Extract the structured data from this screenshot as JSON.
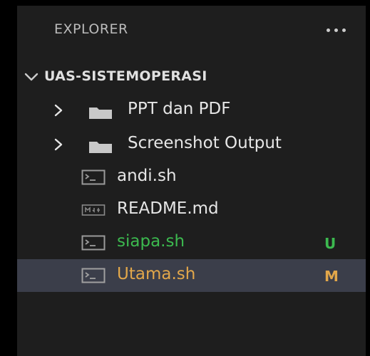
{
  "panel": {
    "title": "EXPLORER",
    "more_icon": "ellipsis-icon"
  },
  "workspace": {
    "name": "UAS-SISTEMOPERASI",
    "expanded": true
  },
  "items": [
    {
      "type": "folder",
      "label": "PPT dan PDF",
      "icon": "folder-icon",
      "expanded": false
    },
    {
      "type": "folder",
      "label": "Screenshot Output",
      "icon": "folder-icon",
      "expanded": false
    },
    {
      "type": "file",
      "label": "andi.sh",
      "icon": "terminal-file-icon"
    },
    {
      "type": "file",
      "label": "README.md",
      "icon": "markdown-file-icon"
    },
    {
      "type": "file",
      "label": "siapa.sh",
      "icon": "terminal-file-icon",
      "git_status": "U"
    },
    {
      "type": "file",
      "label": "Utama.sh",
      "icon": "terminal-file-icon",
      "git_status": "M",
      "selected": true
    }
  ],
  "colors": {
    "background": "#1e1e1e",
    "selected_row": "#3b3e4a",
    "untracked": "#3cb94f",
    "modified": "#e2a74a",
    "text": "#e6e6e6"
  }
}
